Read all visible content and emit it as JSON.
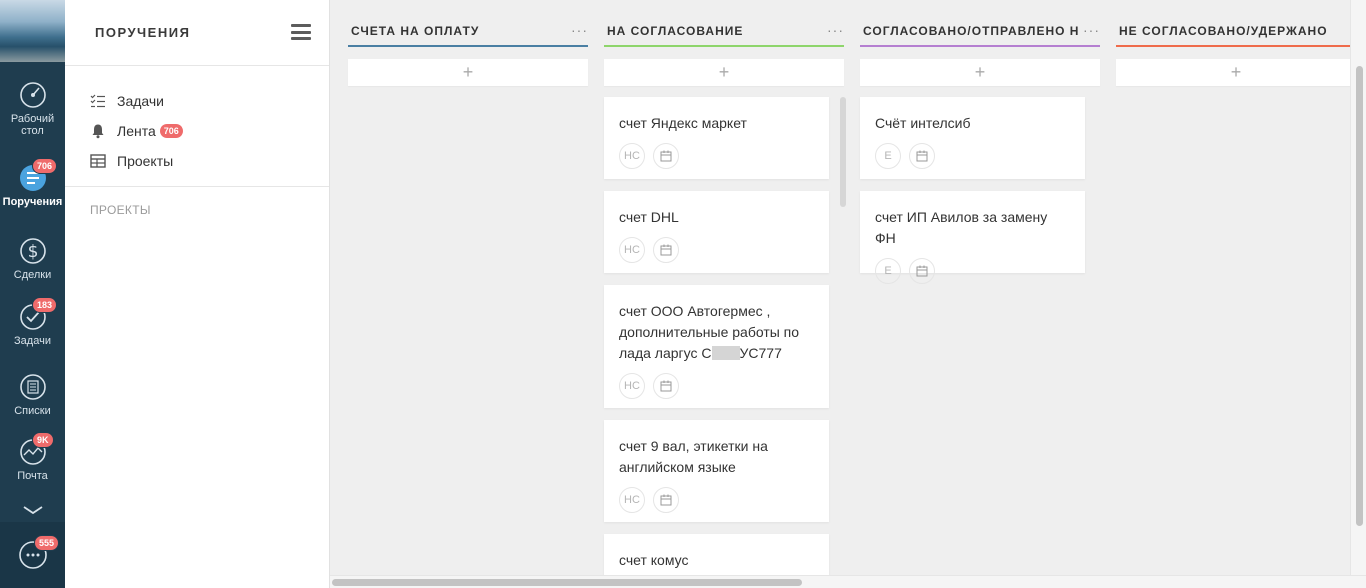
{
  "rail": {
    "items": [
      {
        "label": "Рабочий стол",
        "icon": "dashboard-icon",
        "badge": ""
      },
      {
        "label": "Поручения",
        "icon": "assignments-icon",
        "badge": "706"
      },
      {
        "label": "Сделки",
        "icon": "dollar-icon",
        "badge": ""
      },
      {
        "label": "Задачи",
        "icon": "check-icon",
        "badge": "183"
      },
      {
        "label": "Списки",
        "icon": "list-icon",
        "badge": ""
      },
      {
        "label": "Почта",
        "icon": "mail-icon",
        "badge": "9K"
      },
      {
        "label": "",
        "icon": "chat-icon",
        "badge": "555"
      }
    ]
  },
  "menu": {
    "title": "ПОРУЧЕНИЯ",
    "nav": [
      {
        "label": "Задачи",
        "icon": "tasks-list-icon"
      },
      {
        "label": "Лента",
        "icon": "bell-icon",
        "count": "706"
      },
      {
        "label": "Проекты",
        "icon": "table-icon"
      }
    ],
    "section": "ПРОЕКТЫ"
  },
  "board": {
    "add_symbol": "+",
    "dots": "···",
    "columns": [
      {
        "title": "СЧЕТА НА ОПЛАТУ",
        "color": "#4a7fa3",
        "cards": []
      },
      {
        "title": "НА СОГЛАСОВАНИЕ",
        "color": "#8ed56b",
        "cards": [
          {
            "text": "счет Яндекс маркет",
            "assignee": "НС"
          },
          {
            "text": "счет DHL",
            "assignee": "НС"
          },
          {
            "text_before": "счет ООО Автогермес , дополнительные работы по лада ларгус С",
            "text_after": "УС777",
            "assignee": "НС"
          },
          {
            "text": "счет 9 вал, этикетки на английском языке",
            "assignee": "НС"
          },
          {
            "text": "счет комус",
            "assignee": ""
          }
        ]
      },
      {
        "title": "СОГЛАСОВАНО/ОТПРАВЛЕНО НА ОПЛАТУ",
        "color": "#b57fd1",
        "cards": [
          {
            "text": "Счёт интелсиб",
            "assignee": "Е"
          },
          {
            "text": "счет ИП Авилов за замену ФН",
            "assignee": "Е"
          }
        ]
      },
      {
        "title": "НЕ СОГЛАСОВАНО/УДЕРЖАНО",
        "color": "#ef6b4b",
        "cards": []
      }
    ]
  }
}
